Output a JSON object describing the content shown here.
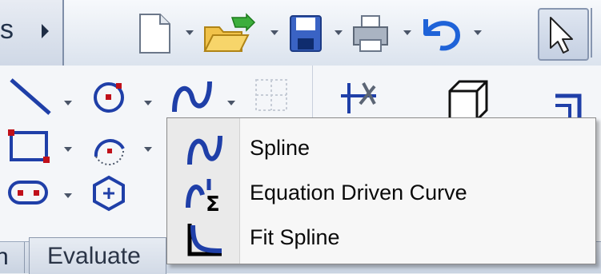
{
  "toolbar": {
    "left_tab_text": "s",
    "buttons": [
      {
        "icon": "new-document-icon"
      },
      {
        "icon": "open-folder-icon"
      },
      {
        "icon": "save-icon"
      },
      {
        "icon": "print-icon"
      },
      {
        "icon": "undo-icon"
      },
      {
        "icon": "select-arrow-icon"
      }
    ]
  },
  "sketch_tools": [
    {
      "icon": "line-icon"
    },
    {
      "icon": "circle-icon"
    },
    {
      "icon": "spline-icon"
    },
    {
      "icon": "grid-icon"
    },
    {
      "icon": "rectangle-icon"
    },
    {
      "icon": "arc-icon"
    },
    {
      "icon": "slot-icon"
    },
    {
      "icon": "polygon-icon"
    },
    {
      "icon": "trim-entities-icon"
    },
    {
      "icon": "box-icon"
    },
    {
      "icon": "offset-icon"
    }
  ],
  "tabs": {
    "previous_tab_label": "n",
    "evaluate_label": "Evaluate"
  },
  "flyout": {
    "items": [
      {
        "label": "Spline",
        "icon": "spline-icon"
      },
      {
        "label": "Equation Driven Curve",
        "icon": "equation-curve-icon"
      },
      {
        "label": "Fit Spline",
        "icon": "fit-spline-icon"
      }
    ]
  },
  "colors": {
    "accent_blue": "#1f3fa8",
    "sketch_red": "#c0101a",
    "menu_bg": "#f7f7f7"
  }
}
